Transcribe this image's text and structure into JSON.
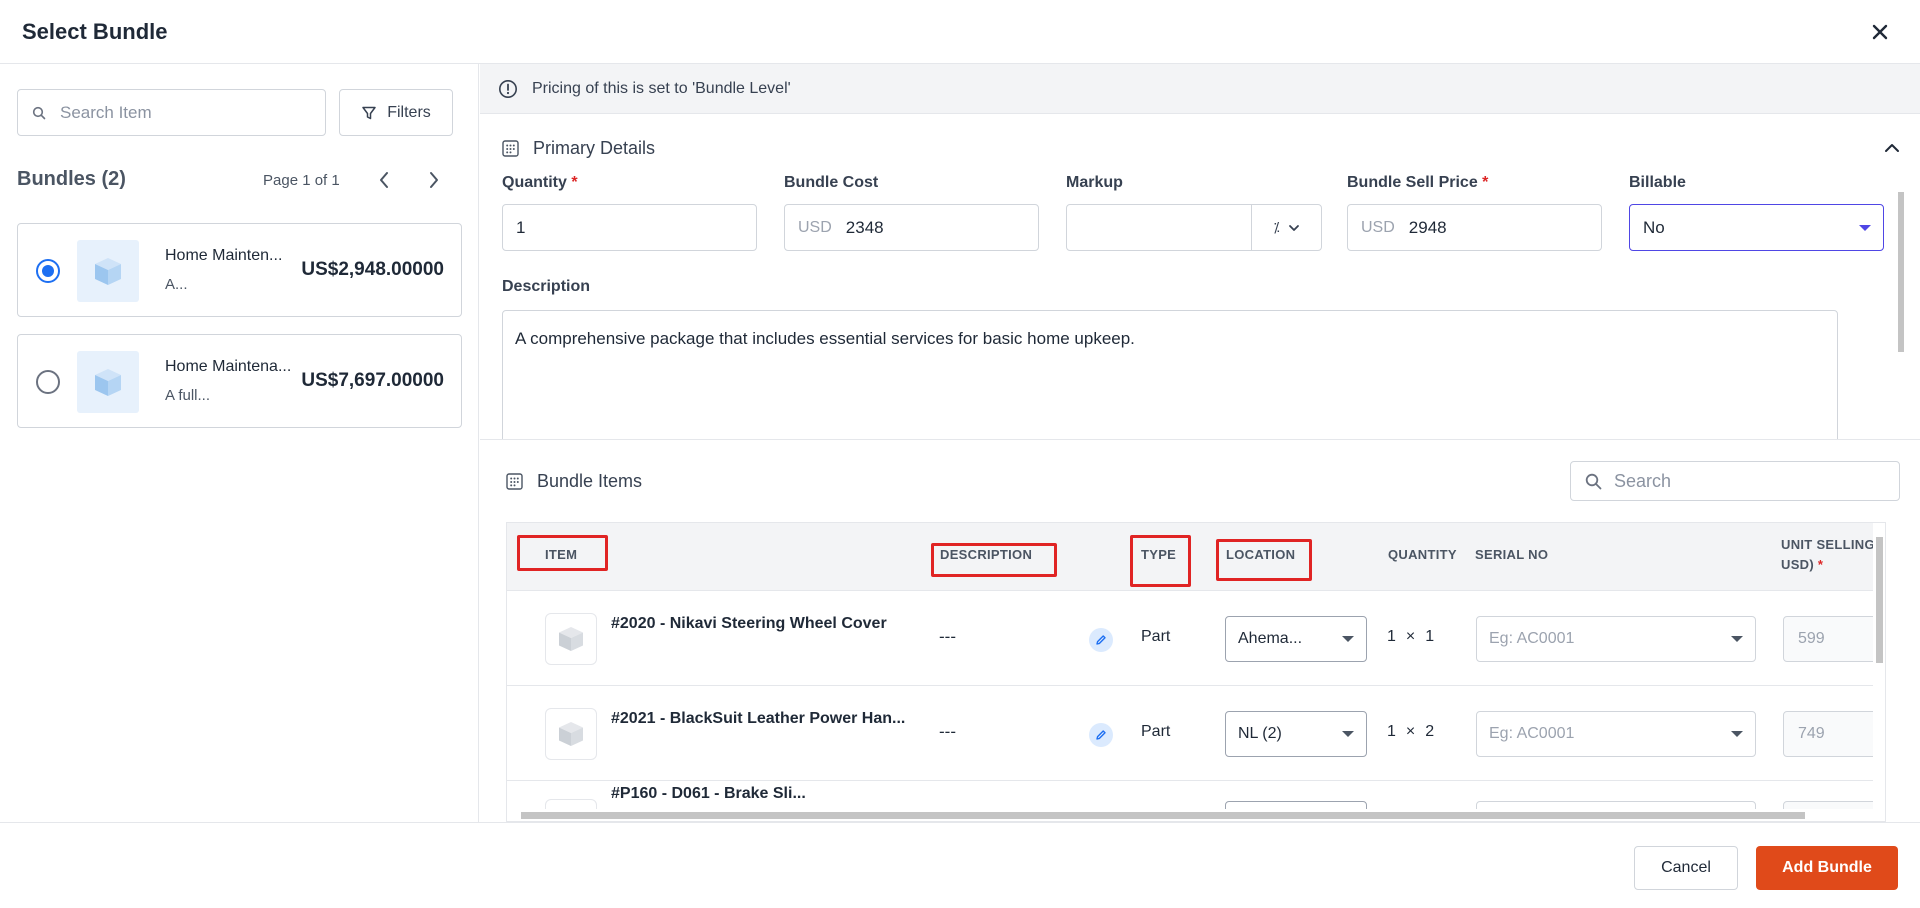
{
  "modal": {
    "title": "Select Bundle"
  },
  "left": {
    "search_placeholder": "Search Item",
    "filters_label": "Filters",
    "bundles_heading": "Bundles (2)",
    "page_info": "Page 1 of 1",
    "bundles": [
      {
        "name": "Home Mainten...",
        "desc": "A...",
        "price": "US$2,948.00000",
        "selected": true
      },
      {
        "name": "Home Maintena...",
        "desc": "A full...",
        "price": "US$7,697.00000",
        "selected": false
      }
    ]
  },
  "info_bar": {
    "text": "Pricing of this is set to 'Bundle Level'"
  },
  "primary": {
    "title": "Primary Details",
    "fields": {
      "quantity": {
        "label": "Quantity",
        "value": "1"
      },
      "bundle_cost": {
        "label": "Bundle Cost",
        "currency": "USD",
        "value": "2348"
      },
      "markup": {
        "label": "Markup",
        "value": "",
        "unit": "⁒"
      },
      "sell_price": {
        "label": "Bundle Sell Price",
        "currency": "USD",
        "value": "2948"
      },
      "billable": {
        "label": "Billable",
        "value": "No"
      }
    },
    "description": {
      "label": "Description",
      "value": "A comprehensive package that includes essential services for basic home upkeep."
    }
  },
  "bundle_items": {
    "title": "Bundle Items",
    "search_placeholder": "Search",
    "columns": {
      "item": "ITEM",
      "description": "DESCRIPTION",
      "type": "TYPE",
      "location": "LOCATION",
      "quantity": "QUANTITY",
      "serial_no": "SERIAL NO",
      "unit_selling_price": "UNIT SELLING P",
      "unit_selling_price_line2": "USD)"
    },
    "rows": [
      {
        "name": "#2020 - Nikavi Steering Wheel Cover",
        "desc": "---",
        "type": "Part",
        "location": "Ahema...",
        "qty_a": "1",
        "qty_x": "×",
        "qty_b": "1",
        "serial_placeholder": "Eg: AC0001",
        "price": "599"
      },
      {
        "name": "#2021 - BlackSuit Leather Power Han...",
        "desc": "---",
        "type": "Part",
        "location": "NL (2)",
        "qty_a": "1",
        "qty_x": "×",
        "qty_b": "2",
        "serial_placeholder": "Eg: AC0001",
        "price": "749"
      },
      {
        "name": "#P160 - D061 - Brake Sli...",
        "desc": "",
        "type": "",
        "location": "",
        "qty_a": "",
        "qty_x": "",
        "qty_b": "",
        "serial_placeholder": "",
        "price": ""
      }
    ]
  },
  "footer": {
    "cancel_label": "Cancel",
    "add_label": "Add Bundle"
  },
  "colors": {
    "accent": "#e04a1a",
    "radio": "#1d6ff2",
    "highlight": "#e02424",
    "billable_border": "#4f46e5"
  },
  "icons": [
    "close-icon",
    "search-icon",
    "filter-icon",
    "chevron-left-icon",
    "chevron-right-icon",
    "box-icon",
    "info-icon",
    "grid-icon",
    "chevron-up-icon",
    "chevron-down-icon",
    "pencil-icon",
    "caret-down-icon"
  ]
}
